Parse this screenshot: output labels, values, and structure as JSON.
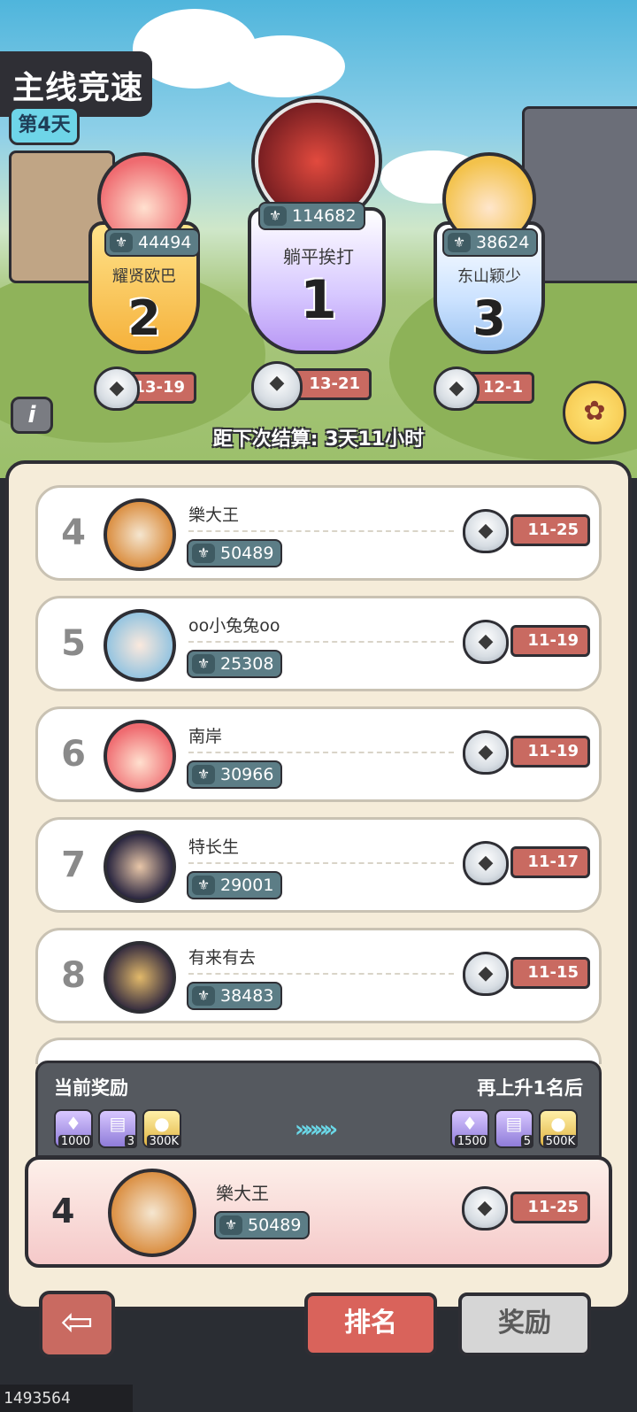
{
  "header": {
    "title": "主线竞速",
    "day_badge": "第4天"
  },
  "podium": [
    {
      "rank": "2",
      "name": "耀贤欧巴",
      "power": "44494",
      "stage": "13-19"
    },
    {
      "rank": "1",
      "name": "躺平挨打",
      "power": "114682",
      "stage": "13-21"
    },
    {
      "rank": "3",
      "name": "东山颖少",
      "power": "38624",
      "stage": "12-1"
    }
  ],
  "countdown": "距下次结算: 3天11小时",
  "leaderboard": [
    {
      "rank": "4",
      "name": "樂大王",
      "power": "50489",
      "stage": "11-25"
    },
    {
      "rank": "5",
      "name": "oo小兔兔oo",
      "power": "25308",
      "stage": "11-19"
    },
    {
      "rank": "6",
      "name": "南岸",
      "power": "30966",
      "stage": "11-19"
    },
    {
      "rank": "7",
      "name": "特长生",
      "power": "29001",
      "stage": "11-17"
    },
    {
      "rank": "8",
      "name": "有来有去",
      "power": "38483",
      "stage": "11-15"
    }
  ],
  "rewards": {
    "current_label": "当前奖励",
    "next_label": "再上升1名后",
    "current": [
      "1000",
      "3",
      "300K"
    ],
    "next": [
      "1500",
      "5",
      "500K"
    ]
  },
  "me": {
    "rank": "4",
    "name": "樂大王",
    "power": "50489",
    "stage": "11-25"
  },
  "tabs": {
    "ranking": "排名",
    "reward": "奖励"
  },
  "footer_id": "1493564 0aabfd"
}
